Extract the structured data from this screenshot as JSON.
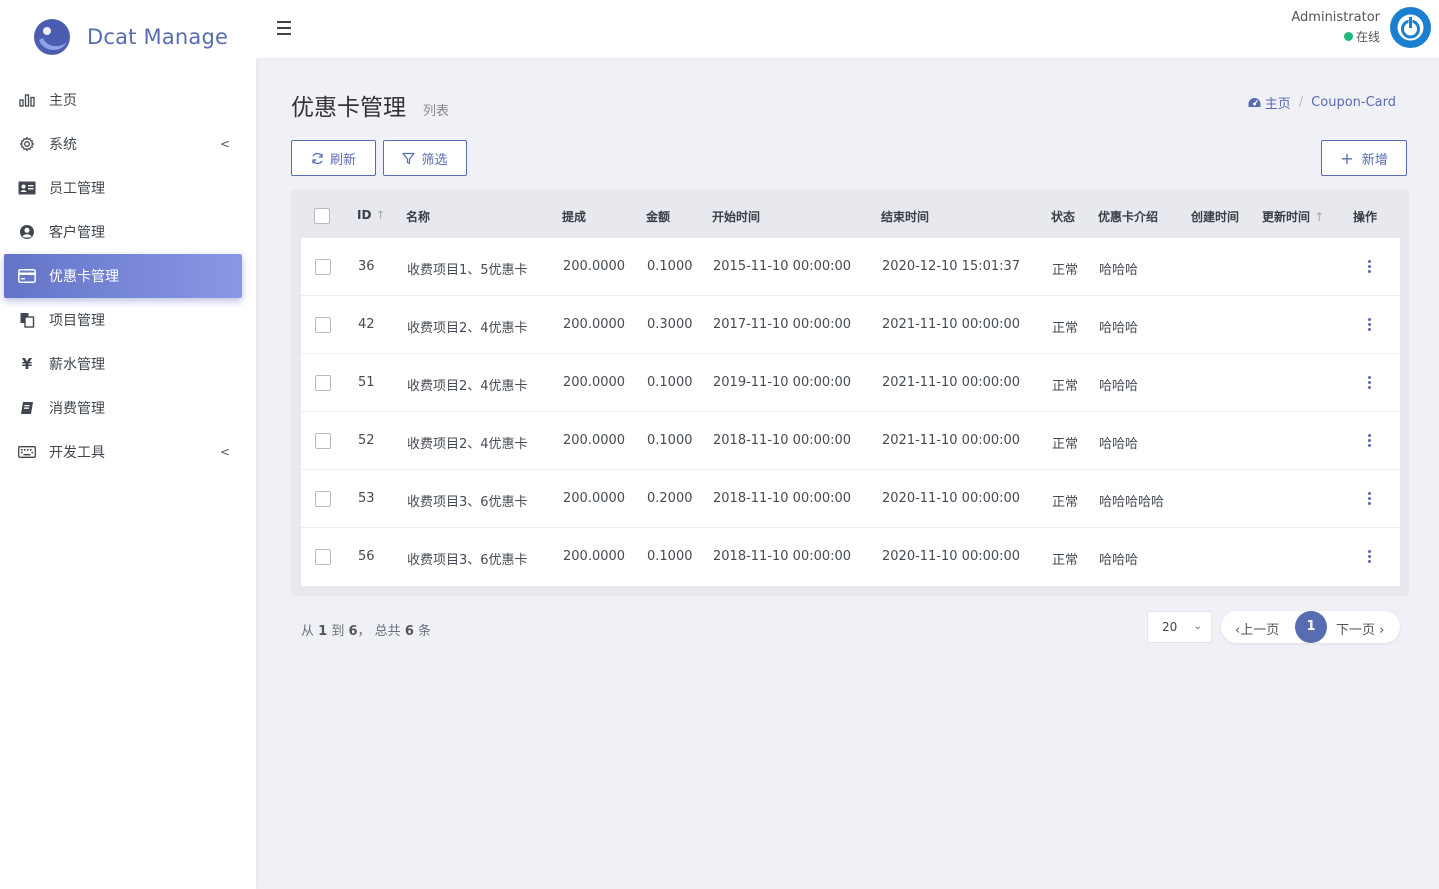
{
  "brand": {
    "name": "Dcat Manage"
  },
  "sidebar": {
    "items": [
      {
        "label": "主页",
        "icon": "bar-chart-icon",
        "chevron": false,
        "active": false
      },
      {
        "label": "系统",
        "icon": "gear-icon",
        "chevron": true,
        "active": false
      },
      {
        "label": "员工管理",
        "icon": "id-card-icon",
        "chevron": false,
        "active": false
      },
      {
        "label": "客户管理",
        "icon": "user-circle-icon",
        "chevron": false,
        "active": false
      },
      {
        "label": "优惠卡管理",
        "icon": "credit-card-icon",
        "chevron": false,
        "active": true
      },
      {
        "label": "项目管理",
        "icon": "copy-icon",
        "chevron": false,
        "active": false
      },
      {
        "label": "薪水管理",
        "icon": "yen-icon",
        "chevron": false,
        "active": false
      },
      {
        "label": "消费管理",
        "icon": "book-icon",
        "chevron": false,
        "active": false
      },
      {
        "label": "开发工具",
        "icon": "keyboard-icon",
        "chevron": true,
        "active": false
      }
    ]
  },
  "header": {
    "user_name": "Administrator",
    "user_status": "在线"
  },
  "page": {
    "title": "优惠卡管理",
    "subtitle": "列表",
    "breadcrumb": [
      {
        "label": "主页"
      },
      {
        "label": "Coupon-Card"
      }
    ]
  },
  "toolbar": {
    "refresh_label": "刷新",
    "filter_label": "筛选",
    "add_label": "新增"
  },
  "table": {
    "columns": [
      "ID",
      "名称",
      "提成",
      "金额",
      "开始时间",
      "结束时间",
      "状态",
      "优惠卡介绍",
      "创建时间",
      "更新时间",
      "操作"
    ],
    "rows": [
      {
        "id": "36",
        "name": "收费项目1、5优惠卡",
        "commission": "200.0000",
        "amount": "0.1000",
        "start": "2015-11-10 00:00:00",
        "end": "2020-12-10 15:01:37",
        "status": "正常",
        "intro": "哈哈哈"
      },
      {
        "id": "42",
        "name": "收费项目2、4优惠卡",
        "commission": "200.0000",
        "amount": "0.3000",
        "start": "2017-11-10 00:00:00",
        "end": "2021-11-10 00:00:00",
        "status": "正常",
        "intro": "哈哈哈"
      },
      {
        "id": "51",
        "name": "收费项目2、4优惠卡",
        "commission": "200.0000",
        "amount": "0.1000",
        "start": "2019-11-10 00:00:00",
        "end": "2021-11-10 00:00:00",
        "status": "正常",
        "intro": "哈哈哈"
      },
      {
        "id": "52",
        "name": "收费项目2、4优惠卡",
        "commission": "200.0000",
        "amount": "0.1000",
        "start": "2018-11-10 00:00:00",
        "end": "2021-11-10 00:00:00",
        "status": "正常",
        "intro": "哈哈哈"
      },
      {
        "id": "53",
        "name": "收费项目3、6优惠卡",
        "commission": "200.0000",
        "amount": "0.2000",
        "start": "2018-11-10 00:00:00",
        "end": "2020-11-10 00:00:00",
        "status": "正常",
        "intro": "哈哈哈哈哈"
      },
      {
        "id": "56",
        "name": "收费项目3、6优惠卡",
        "commission": "200.0000",
        "amount": "0.1000",
        "start": "2018-11-10 00:00:00",
        "end": "2020-11-10 00:00:00",
        "status": "正常",
        "intro": "哈哈哈"
      }
    ]
  },
  "footer": {
    "summary_prefix": "从",
    "from": "1",
    "to_word": "到",
    "to": "6",
    "total_word": "，  总共",
    "total": "6",
    "unit": "条",
    "per_page": "20",
    "prev_label": "上一页",
    "current_page": "1",
    "next_label": "下一页"
  },
  "colors": {
    "primary": "#586cb1",
    "active_gradient_start": "#6374c8",
    "online": "#21b978",
    "avatar": "#1a7fd0"
  }
}
